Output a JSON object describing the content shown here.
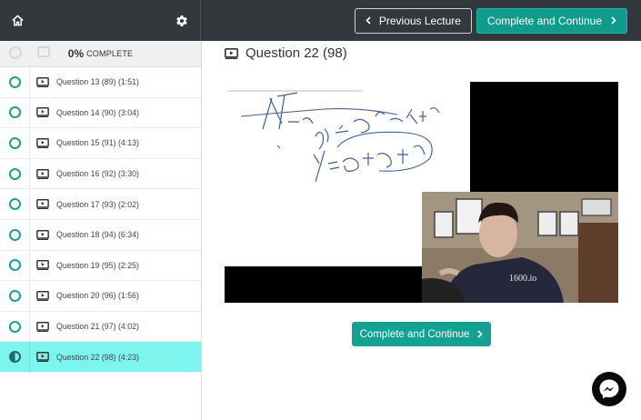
{
  "topbar": {
    "home_icon": "home-icon",
    "settings_icon": "gear-icon",
    "prev_label": "Previous Lecture",
    "next_label": "Complete and Continue"
  },
  "progress": {
    "percent": "0%",
    "label": "COMPLETE"
  },
  "lessons": [
    {
      "title": "Question 13 (89) (1:51)"
    },
    {
      "title": "Question 14 (90) (3:04)"
    },
    {
      "title": "Question 15 (91) (4:13)"
    },
    {
      "title": "Question 16 (92) (3:30)"
    },
    {
      "title": "Question 17 (93) (2:02)"
    },
    {
      "title": "Question 18 (94) (6:34)"
    },
    {
      "title": "Question 19 (95) (2:25)"
    },
    {
      "title": "Question 20 (96) (1:56)"
    },
    {
      "title": "Question 21 (97) (4:02)"
    },
    {
      "title": "Question 22 (98) (4:23)"
    }
  ],
  "main": {
    "title": "Question 22 (98)",
    "video_watermark": "1600.io",
    "complete_label": "Complete and Continue"
  },
  "colors": {
    "accent": "#13a192",
    "topbar": "#33383c",
    "active_lesson": "#7ef4ee"
  }
}
